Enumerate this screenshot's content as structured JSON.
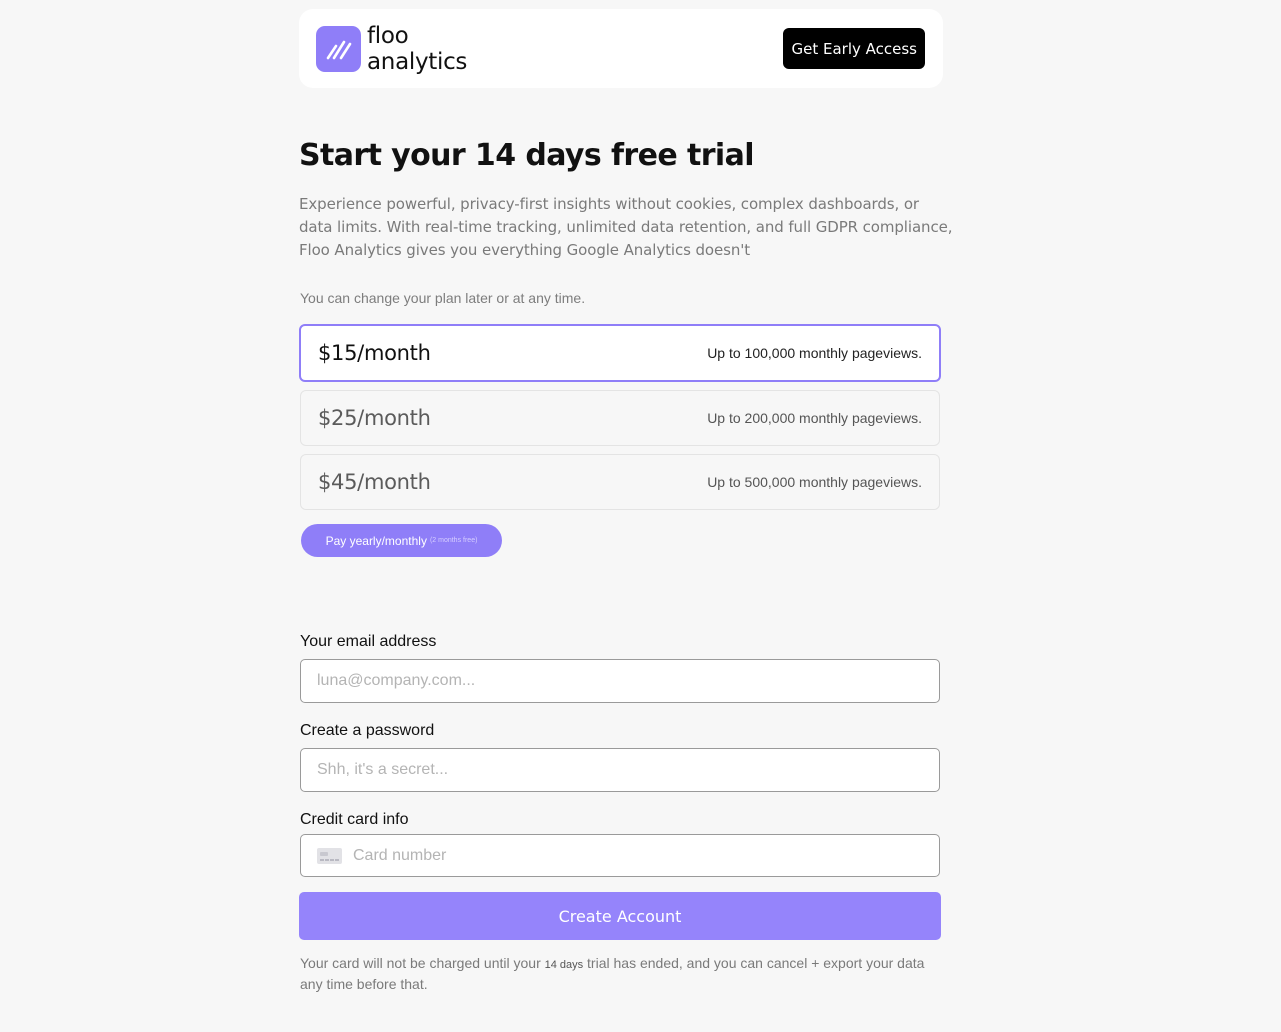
{
  "header": {
    "brand_line1": "floo",
    "brand_line2": "analytics",
    "cta_label": "Get Early Access",
    "accent_color": "#8f7ef8"
  },
  "hero": {
    "title": "Start your 14 days free trial",
    "description": "Experience powerful, privacy-first insights without cookies, complex dashboards, or data limits. With real-time tracking, unlimited data retention, and full GDPR compliance, Floo Analytics gives you everything Google Analytics doesn't"
  },
  "plans": {
    "note": "You can change your plan later or at any time.",
    "items": [
      {
        "price": "$15/month",
        "description": "Up to 100,000 monthly pageviews.",
        "selected": true
      },
      {
        "price": "$25/month",
        "description": "Up to 200,000 monthly pageviews.",
        "selected": false
      },
      {
        "price": "$45/month",
        "description": "Up to 500,000 monthly pageviews.",
        "selected": false
      }
    ],
    "billing_toggle": "Pay yearly/monthly",
    "billing_toggle_note": "(2 months free)"
  },
  "form": {
    "email_label": "Your email address",
    "email_placeholder": "luna@company.com...",
    "password_label": "Create a password",
    "password_placeholder": "Shh, it's a secret...",
    "card_label": "Credit card info",
    "card_placeholder": "Card number",
    "card_icon": "credit-card-icon",
    "submit_label": "Create Account",
    "submit_color": "#9584fb"
  },
  "footer": {
    "disclaimer_part1": "Your card will not be charged until your",
    "disclaimer_small": "14 days",
    "disclaimer_part2": "trial has ended, and you can cancel + export your data any time before that."
  }
}
